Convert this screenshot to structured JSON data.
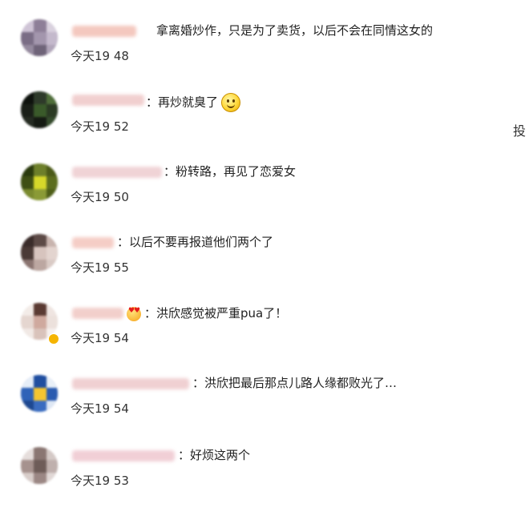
{
  "comments": [
    {
      "text": "拿离婚炒作，只是为了卖货，以后不会在同情这女的",
      "time": "今天19 48"
    },
    {
      "text": "：再炒就臭了",
      "time": "今天19 52",
      "emoji": "smiley-icon"
    },
    {
      "text": "：粉转路，再见了恋爱女",
      "time": "今天19 50"
    },
    {
      "text": "：以后不要再报道他们两个了",
      "time": "今天19 55"
    },
    {
      "text": "：洪欣感觉被严重pua了！",
      "time": "今天19 54",
      "emoji": "heart-eyes-icon"
    },
    {
      "text": "：洪欣把最后那点儿路人缘都败光了…",
      "time": "今天19 54"
    },
    {
      "text": "：好烦这两个",
      "time": "今天19 53"
    }
  ],
  "side_text": "投",
  "colors": {
    "name_blur": "#f3c9c2",
    "text": "#222222",
    "time": "#333333"
  }
}
